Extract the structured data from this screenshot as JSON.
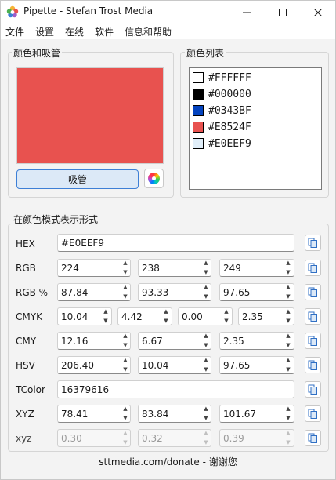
{
  "window": {
    "title": "Pipette - Stefan Trost Media",
    "min_icon": "minimize-icon",
    "max_icon": "maximize-icon",
    "close_icon": "close-icon"
  },
  "menu": [
    "文件",
    "设置",
    "在线",
    "软件",
    "信息和帮助"
  ],
  "color_picker": {
    "group_title": "颜色和吸管",
    "current_color": "#E8524F",
    "pipette_label": "吸管",
    "wheel_icon": "color-wheel-icon"
  },
  "color_list": {
    "group_title": "颜色列表",
    "items": [
      {
        "hex": "#FFFFFF",
        "color": "#FFFFFF"
      },
      {
        "hex": "#000000",
        "color": "#000000"
      },
      {
        "hex": "#0343BF",
        "color": "#0343BF"
      },
      {
        "hex": "#E8524F",
        "color": "#E8524F"
      },
      {
        "hex": "#E0EEF9",
        "color": "#E0EEF9"
      }
    ]
  },
  "formats": {
    "group_title": "在颜色模式表示形式",
    "rows": {
      "hex": {
        "label": "HEX",
        "value": "#E0EEF9"
      },
      "rgb": {
        "label": "RGB",
        "values": [
          "224",
          "238",
          "249"
        ]
      },
      "rgbpct": {
        "label": "RGB %",
        "values": [
          "87.84",
          "93.33",
          "97.65"
        ]
      },
      "cmyk": {
        "label": "CMYK",
        "values": [
          "10.04",
          "4.42",
          "0.00",
          "2.35"
        ]
      },
      "cmy": {
        "label": "CMY",
        "values": [
          "12.16",
          "6.67",
          "2.35"
        ]
      },
      "hsv": {
        "label": "HSV",
        "values": [
          "206.40",
          "10.04",
          "97.65"
        ]
      },
      "tcolor": {
        "label": "TColor",
        "value": "16379616"
      },
      "xyz": {
        "label": "XYZ",
        "values": [
          "78.41",
          "83.84",
          "101.67"
        ]
      },
      "xyz_small": {
        "label": "xyz",
        "values": [
          "0.30",
          "0.32",
          "0.39"
        ]
      }
    },
    "copy_icon": "copy-icon"
  },
  "footer": "sttmedia.com/donate - 谢谢您",
  "accent_color": "#3D7FD6"
}
